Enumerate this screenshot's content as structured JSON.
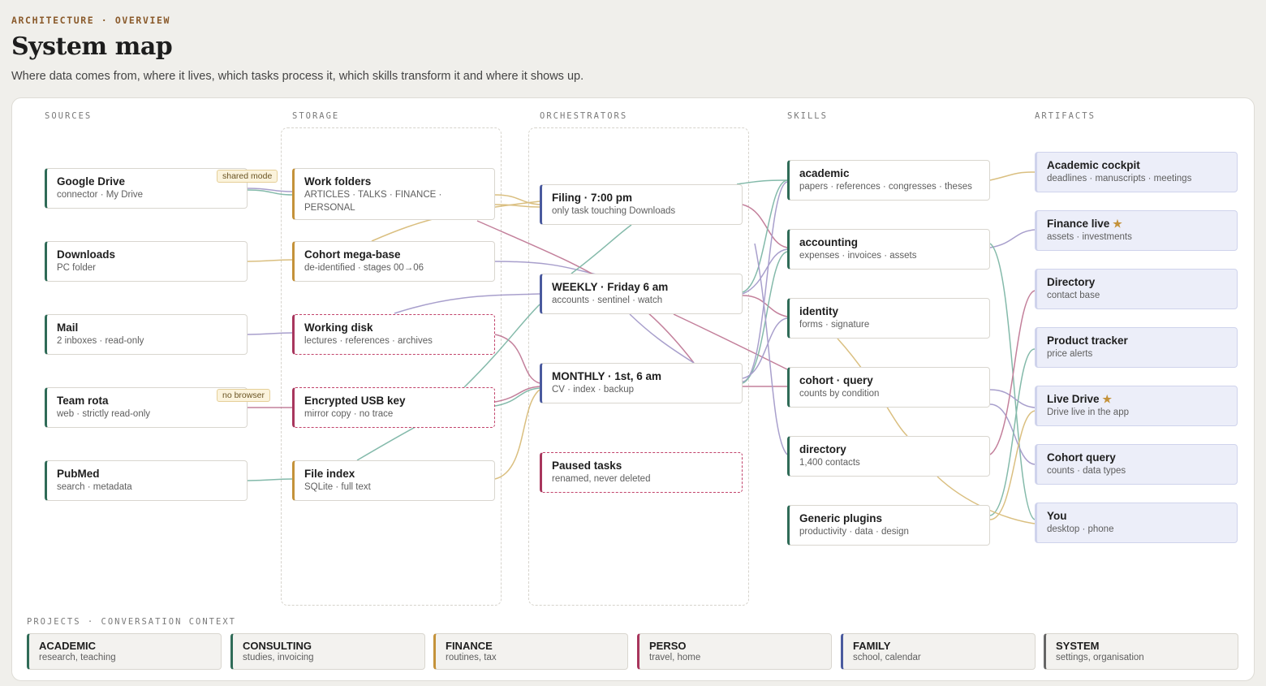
{
  "header": {
    "eyebrow": "ARCHITECTURE · OVERVIEW",
    "title": "System map",
    "subtitle": "Where data comes from, where it lives, which tasks process it, which skills transform it and where it shows up."
  },
  "columns": {
    "sources": "SOURCES",
    "storage": "STORAGE",
    "orchestrators": "ORCHESTRATORS",
    "skills": "SKILLS",
    "artifacts": "ARTIFACTS"
  },
  "sources": [
    {
      "title": "Google Drive",
      "sub": "connector · My Drive",
      "badge": "shared mode"
    },
    {
      "title": "Downloads",
      "sub": "PC folder"
    },
    {
      "title": "Mail",
      "sub": "2 inboxes · read-only"
    },
    {
      "title": "Team rota",
      "sub": "web · strictly read-only",
      "badge": "no browser"
    },
    {
      "title": "PubMed",
      "sub": "search · metadata"
    }
  ],
  "storage": [
    {
      "title": "Work folders",
      "sub": "ARTICLES · TALKS · FINANCE · PERSONAL"
    },
    {
      "title": "Cohort mega-base",
      "sub": "de-identified · stages 00→06"
    },
    {
      "title": "Working disk",
      "sub": "lectures · references · archives"
    },
    {
      "title": "Encrypted USB key",
      "sub": "mirror copy · no trace"
    },
    {
      "title": "File index",
      "sub": "SQLite · full text"
    }
  ],
  "orchestrators": [
    {
      "title": "Filing · 7:00 pm",
      "sub": "only task touching Downloads"
    },
    {
      "title": "WEEKLY · Friday 6 am",
      "sub": "accounts · sentinel · watch"
    },
    {
      "title": "MONTHLY · 1st, 6 am",
      "sub": "CV · index · backup"
    },
    {
      "title": "Paused tasks",
      "sub": "renamed, never deleted"
    }
  ],
  "skills": [
    {
      "title": "academic",
      "sub": "papers · references · congresses · theses"
    },
    {
      "title": "accounting",
      "sub": "expenses · invoices · assets"
    },
    {
      "title": "identity",
      "sub": "forms · signature"
    },
    {
      "title": "cohort · query",
      "sub": "counts by condition"
    },
    {
      "title": "directory",
      "sub": "1,400 contacts"
    },
    {
      "title": "Generic plugins",
      "sub": "productivity · data · design"
    }
  ],
  "artifacts": [
    {
      "title": "Academic cockpit",
      "sub": "deadlines · manuscripts · meetings",
      "star": ""
    },
    {
      "title": "Finance live",
      "sub": "assets · investments",
      "star": "★"
    },
    {
      "title": "Directory",
      "sub": "contact base",
      "star": ""
    },
    {
      "title": "Product tracker",
      "sub": "price alerts",
      "star": ""
    },
    {
      "title": "Live Drive",
      "sub": "Drive live in the app",
      "star": "★"
    },
    {
      "title": "Cohort query",
      "sub": "counts · data types",
      "star": ""
    },
    {
      "title": "You",
      "sub": "desktop · phone",
      "star": ""
    }
  ],
  "projects": {
    "heading": "PROJECTS · CONVERSATION CONTEXT",
    "items": [
      {
        "title": "ACADEMIC",
        "sub": "research, teaching"
      },
      {
        "title": "CONSULTING",
        "sub": "studies, invoicing"
      },
      {
        "title": "FINANCE",
        "sub": "routines, tax"
      },
      {
        "title": "PERSO",
        "sub": "travel, home"
      },
      {
        "title": "FAMILY",
        "sub": "school, calendar"
      },
      {
        "title": "SYSTEM",
        "sub": "settings, organisation"
      }
    ]
  },
  "colors": {
    "green": "#2f6b57",
    "gold": "#c4923a",
    "blue": "#4a5a9e",
    "rose": "#a8365d",
    "teal": "#6fae9c",
    "purple": "#9a8fc4",
    "pink": "#b96a8a",
    "sand": "#d4b46a"
  }
}
